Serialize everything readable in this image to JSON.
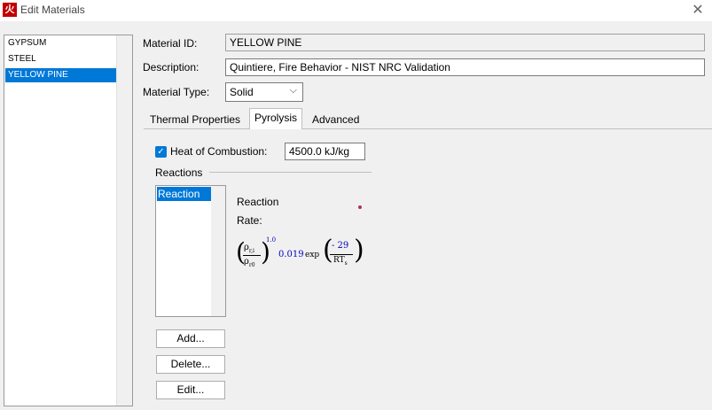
{
  "window": {
    "title": "Edit Materials",
    "app_icon_glyph": "火",
    "close_glyph": "✕"
  },
  "materials": [
    {
      "name": "GYPSUM",
      "selected": false
    },
    {
      "name": "STEEL",
      "selected": false
    },
    {
      "name": "YELLOW PINE",
      "selected": true
    }
  ],
  "form": {
    "id_label": "Material ID:",
    "id_value": "YELLOW PINE",
    "desc_label": "Description:",
    "desc_value": "Quintiere, Fire Behavior - NIST NRC Validation",
    "type_label": "Material Type:",
    "type_value": "Solid"
  },
  "tabs": [
    {
      "label": "Thermal Properties",
      "active": false
    },
    {
      "label": "Pyrolysis",
      "active": true
    },
    {
      "label": "Advanced",
      "active": false
    }
  ],
  "pyrolysis": {
    "heat_label": "Heat of Combustion:",
    "heat_checked": true,
    "heat_value": "4500.0 kJ/kg",
    "reactions_label": "Reactions",
    "reactions": [
      "Reaction"
    ],
    "rate_title": "Reaction",
    "rate_label": "Rate:",
    "formula": {
      "rho_top": "ρ",
      "rho_top_sub": "r,i",
      "rho_bot": "ρ",
      "rho_bot_sub": "r0",
      "exponent": "1.0",
      "coefficient": "0.019",
      "exp": "exp",
      "numerator": "- 29",
      "denominator": "RT",
      "denominator_sub": "s"
    },
    "buttons": {
      "add": "Add...",
      "delete": "Delete...",
      "edit": "Edit..."
    }
  },
  "colors": {
    "accent": "#0078d7",
    "formula_blue": "#0000c0"
  }
}
